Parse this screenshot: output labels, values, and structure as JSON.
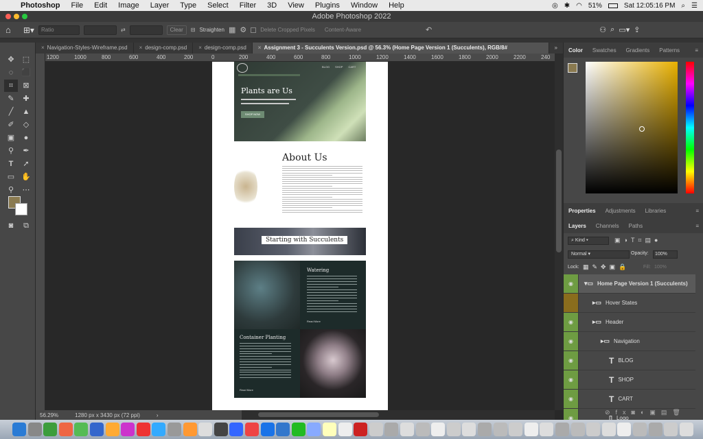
{
  "menubar": {
    "app_name": "Photoshop",
    "items": [
      "File",
      "Edit",
      "Image",
      "Layer",
      "Type",
      "Select",
      "Filter",
      "3D",
      "View",
      "Plugins",
      "Window",
      "Help"
    ],
    "battery": "51%",
    "clock": "Sat 12:05:16 PM"
  },
  "window_title": "Adobe Photoshop 2022",
  "options": {
    "ratio": "Ratio",
    "clear": "Clear",
    "straighten": "Straighten",
    "delete_cropped": "Delete Cropped Pixels",
    "content_aware": "Content-Aware"
  },
  "tabs": [
    {
      "label": "Navigation-Styles-Wireframe.psd"
    },
    {
      "label": "design-comp.psd"
    },
    {
      "label": "design-comp.psd"
    },
    {
      "label": "Assignment 3 - Succulents Version.psd @ 56.3% (Home Page Version 1 (Succulents), RGB/8#"
    }
  ],
  "ruler_labels": [
    "1200",
    "1000",
    "800",
    "600",
    "400",
    "200",
    "0",
    "200",
    "400",
    "600",
    "800",
    "1000",
    "1200",
    "1400",
    "1600",
    "1800",
    "2000",
    "2200",
    "240"
  ],
  "status": {
    "zoom": "56.29%",
    "doc_size": "1280 px x 3430 px (72 ppi)"
  },
  "document": {
    "hero_title": "Plants are Us",
    "hero_button": "SHOP NOW",
    "nav": [
      "BLOG",
      "SHOP",
      "CART"
    ],
    "about_title": "About Us",
    "banner_title": "Starting with Succulents",
    "watering_title": "Watering",
    "read_more": "Read More",
    "container_title": "Container Planting"
  },
  "panels": {
    "color_tabs": [
      "Color",
      "Swatches",
      "Gradients",
      "Patterns"
    ],
    "prop_tabs": [
      "Properties",
      "Adjustments",
      "Libraries"
    ],
    "layer_tabs": [
      "Layers",
      "Channels",
      "Paths"
    ],
    "kind": "Kind",
    "blend": "Normal",
    "opacity_label": "Opacity:",
    "opacity": "100%",
    "lock_label": "Lock:",
    "fill_label": "Fill:",
    "fill": "100%",
    "layers": [
      {
        "name": "Home Page Version 1 (Succulents)",
        "type": "group",
        "indent": 0
      },
      {
        "name": "Hover States",
        "type": "folder",
        "indent": 1
      },
      {
        "name": "Header",
        "type": "folder",
        "indent": 1
      },
      {
        "name": "Navigation",
        "type": "folder",
        "indent": 2
      },
      {
        "name": "BLOG",
        "type": "text",
        "indent": 3
      },
      {
        "name": "SHOP",
        "type": "text",
        "indent": 3
      },
      {
        "name": "CART",
        "type": "text",
        "indent": 3
      },
      {
        "name": "Logo",
        "type": "image",
        "indent": 3
      }
    ]
  },
  "colors": {
    "foreground": "#8a7a50",
    "accent": "#6e9c42"
  }
}
